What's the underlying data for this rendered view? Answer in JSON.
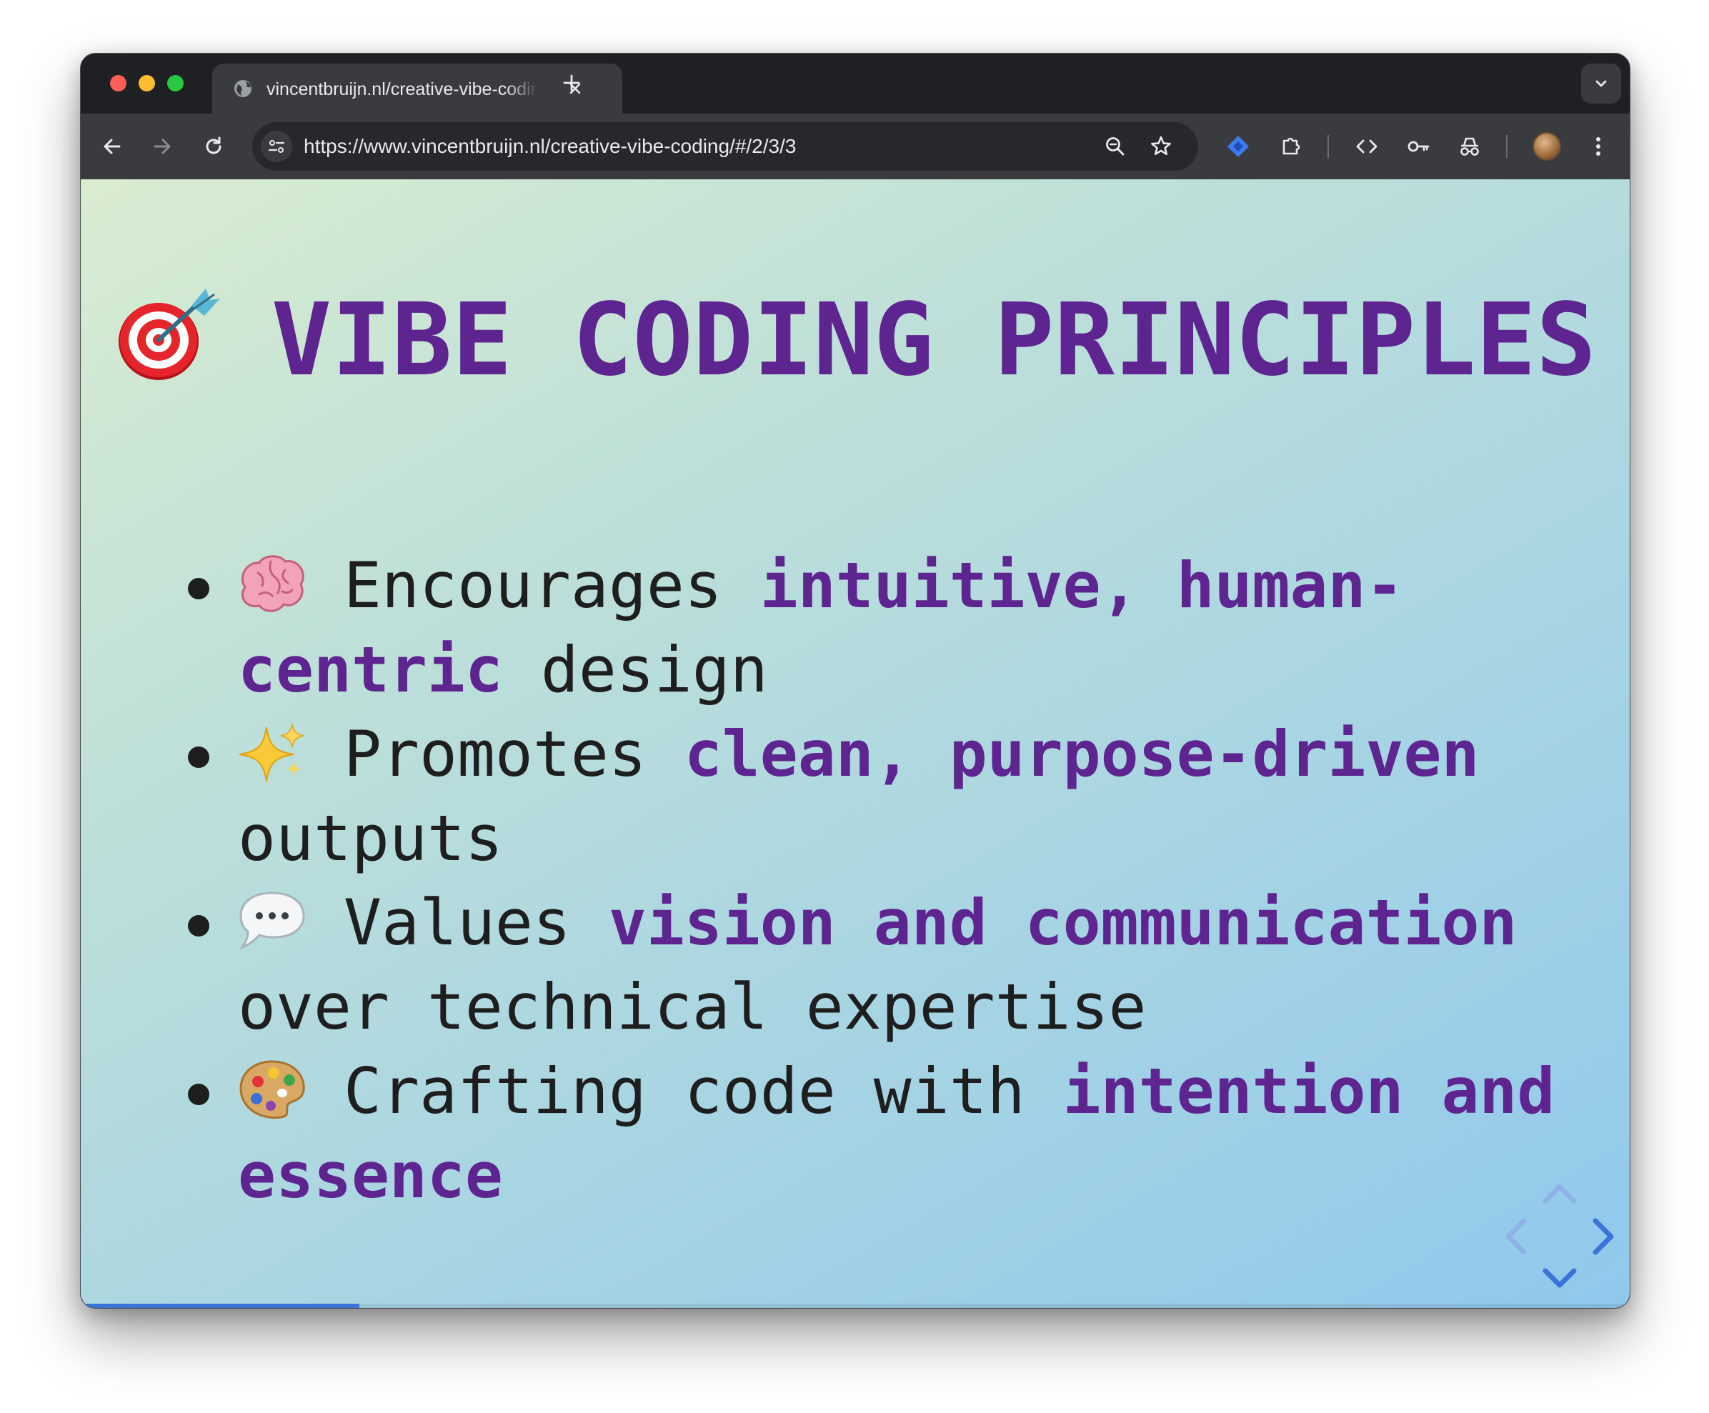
{
  "browser": {
    "tab_title": "vincentbruijn.nl/creative-vibe-coding",
    "url": "https://www.vincentbruijn.nl/creative-vibe-coding/#/2/3/3"
  },
  "slide": {
    "title_emoji": "dart-target-icon",
    "title": "VIBE CODING PRINCIPLES",
    "bullets": [
      {
        "icon": "brain-icon",
        "pre": "Encourages ",
        "highlight": "intuitive, human-centric",
        "post": " design"
      },
      {
        "icon": "sparkles-icon",
        "pre": "Promotes ",
        "highlight": "clean, purpose-driven",
        "post": " outputs"
      },
      {
        "icon": "speech-bubble-icon",
        "pre": "Values ",
        "highlight": "vision and communication",
        "post": " over technical expertise"
      },
      {
        "icon": "palette-icon",
        "pre": "Crafting code with ",
        "highlight": "intention and essence",
        "post": ""
      }
    ]
  },
  "progress": 0.18,
  "colors": {
    "accent_purple": "#5e2490",
    "progress_blue": "#3b74d9",
    "nav_blue": "#3b74d9"
  }
}
